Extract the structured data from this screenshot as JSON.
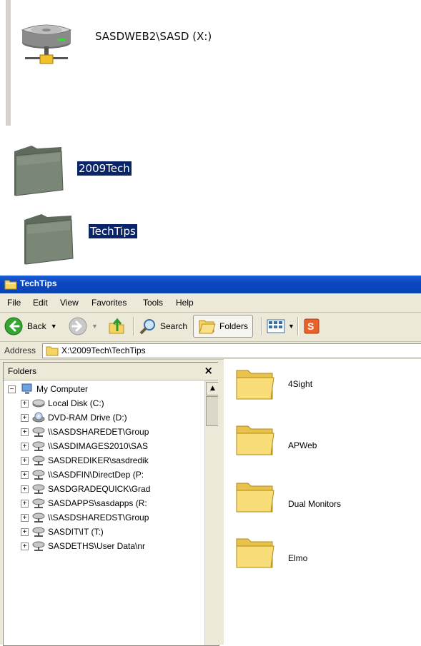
{
  "desktop": {
    "network_drive_label": "SASDWEB2\\SASD (X:)",
    "folders": [
      {
        "label": "2009Tech"
      },
      {
        "label": "TechTips"
      }
    ]
  },
  "window": {
    "title": "TechTips",
    "menu": [
      "File",
      "Edit",
      "View",
      "Favorites",
      "Tools",
      "Help"
    ],
    "toolbar": {
      "back_label": "Back",
      "search_label": "Search",
      "folders_label": "Folders"
    },
    "address": {
      "label": "Address",
      "value": "X:\\2009Tech\\TechTips"
    },
    "folders_pane": {
      "title": "Folders",
      "close_glyph": "×",
      "tree": [
        {
          "label": "My Computer",
          "expander": "−",
          "icon": "computer-icon"
        },
        {
          "label": "Local Disk (C:)",
          "expander": "+",
          "icon": "hard-disk-icon"
        },
        {
          "label": "DVD-RAM Drive (D:)",
          "expander": "+",
          "icon": "dvd-drive-icon"
        },
        {
          "label": "\\\\SASDSHAREDET\\Group",
          "expander": "+",
          "icon": "network-drive-icon"
        },
        {
          "label": "\\\\SASDIMAGES2010\\SAS",
          "expander": "+",
          "icon": "network-drive-icon"
        },
        {
          "label": "SASDREDIKER\\sasdredik",
          "expander": "+",
          "icon": "network-drive-icon"
        },
        {
          "label": "\\\\SASDFIN\\DirectDep (P:",
          "expander": "+",
          "icon": "network-drive-icon"
        },
        {
          "label": "SASDGRADEQUICK\\Grad",
          "expander": "+",
          "icon": "network-drive-icon"
        },
        {
          "label": "SASDAPPS\\sasdapps (R:",
          "expander": "+",
          "icon": "network-drive-icon"
        },
        {
          "label": "\\\\SASDSHAREDST\\Group",
          "expander": "+",
          "icon": "network-drive-icon"
        },
        {
          "label": "SASDIT\\IT (T:)",
          "expander": "+",
          "icon": "network-drive-icon"
        },
        {
          "label": "SASDETHS\\User Data\\nr",
          "expander": "+",
          "icon": "network-drive-icon"
        }
      ]
    },
    "content": {
      "items": [
        {
          "label": "4Sight"
        },
        {
          "label": "APWeb"
        },
        {
          "label": "Dual Monitors"
        },
        {
          "label": "Elmo"
        }
      ]
    }
  }
}
